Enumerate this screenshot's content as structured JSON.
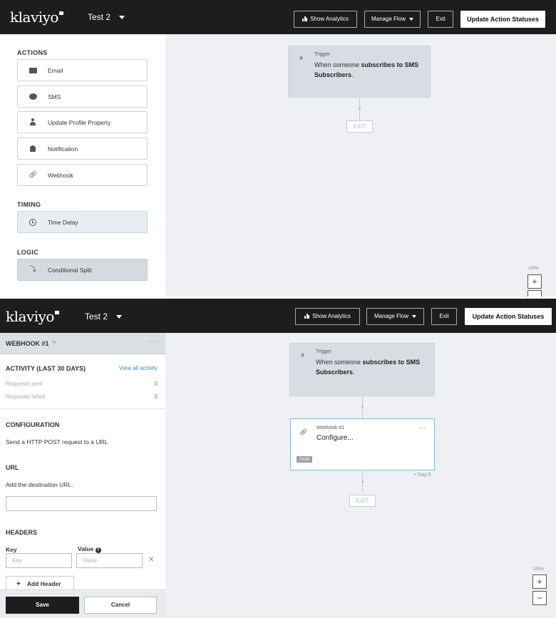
{
  "topbar": {
    "logo": "klaviyo",
    "flow_name": "Test 2",
    "show_analytics": "Show Analytics",
    "manage_flow": "Manage Flow",
    "exit": "Exit",
    "update_statuses": "Update Action Statuses"
  },
  "builder": {
    "actions_title": "ACTIONS",
    "actions": [
      {
        "label": "Email",
        "icon": "envelope-icon"
      },
      {
        "label": "SMS",
        "icon": "chat-bubble-icon"
      },
      {
        "label": "Update Profile Property",
        "icon": "person-icon"
      },
      {
        "label": "Notification",
        "icon": "bell-icon"
      },
      {
        "label": "Webhook",
        "icon": "webhook-link-icon"
      }
    ],
    "timing_title": "TIMING",
    "timing_item": "Time Delay",
    "logic_title": "LOGIC",
    "logic_item": "Conditional Split"
  },
  "canvas": {
    "trigger_small": "Trigger",
    "trigger_pre": "When someone ",
    "trigger_bold": "subscribes to SMS Subscribers",
    "trigger_end": ".",
    "exit_label": "EXIT",
    "zoom_level": "100%",
    "zoom_in": "+",
    "zoom_out": "−"
  },
  "webhook_panel": {
    "title": "WEBHOOK #1",
    "more": "···",
    "activity_title": "ACTIVITY (LAST 30 DAYS)",
    "view_all": "View all activity",
    "requests_sent_label": "Requests sent",
    "requests_sent_value": "0",
    "requests_failed_label": "Requests failed",
    "requests_failed_value": "0",
    "config_title": "CONFIGURATION",
    "config_text": "Send a HTTP POST request to a URL",
    "url_title": "URL",
    "url_text": "Add the destination URL.",
    "url_value": "",
    "headers_title": "HEADERS",
    "key_label": "Key",
    "value_label": "Value",
    "key_placeholder": "Key",
    "value_placeholder": "Value",
    "add_header": "Add Header",
    "save": "Save",
    "cancel": "Cancel"
  },
  "webhook_card": {
    "small": "Webhook #1",
    "big": "Configure...",
    "badge": "Draft",
    "more": "···",
    "day_label": "+ Day 0"
  }
}
